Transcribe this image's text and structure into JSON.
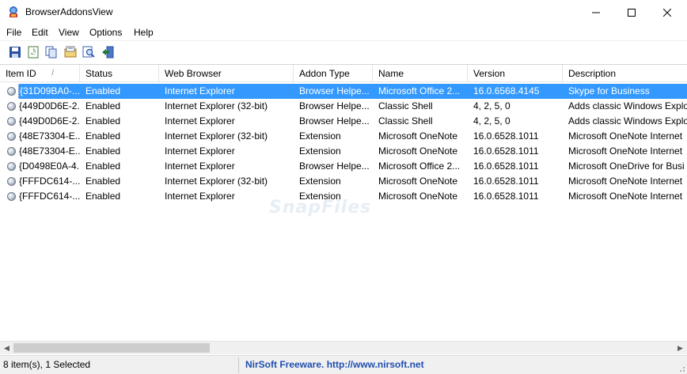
{
  "window": {
    "title": "BrowserAddonsView",
    "controls": [
      "minimize",
      "maximize",
      "close"
    ]
  },
  "menu": {
    "items": [
      {
        "label": "File",
        "name": "menu-file"
      },
      {
        "label": "Edit",
        "name": "menu-edit"
      },
      {
        "label": "View",
        "name": "menu-view"
      },
      {
        "label": "Options",
        "name": "menu-options"
      },
      {
        "label": "Help",
        "name": "menu-help"
      }
    ]
  },
  "toolbar": {
    "buttons": [
      {
        "icon": "save-icon"
      },
      {
        "icon": "refresh-icon"
      },
      {
        "icon": "copy-icon"
      },
      {
        "icon": "html-report-icon"
      },
      {
        "icon": "find-icon"
      },
      {
        "icon": "exit-icon"
      }
    ]
  },
  "table": {
    "columns": [
      "Item ID",
      "Status",
      "Web Browser",
      "Addon Type",
      "Name",
      "Version",
      "Description"
    ],
    "sort_indicator": "/",
    "rows": [
      {
        "id": "{31D09BA0-...",
        "status": "Enabled",
        "browser": "Internet Explorer",
        "type": "Browser Helpe...",
        "name": "Microsoft Office 2...",
        "version": "16.0.6568.4145",
        "description": "Skype for Business",
        "selected": true
      },
      {
        "id": "{449D0D6E-2...",
        "status": "Enabled",
        "browser": "Internet Explorer (32-bit)",
        "type": "Browser Helpe...",
        "name": "Classic Shell",
        "version": "4, 2, 5, 0",
        "description": "Adds classic Windows Explo",
        "selected": false
      },
      {
        "id": "{449D0D6E-2...",
        "status": "Enabled",
        "browser": "Internet Explorer",
        "type": "Browser Helpe...",
        "name": "Classic Shell",
        "version": "4, 2, 5, 0",
        "description": "Adds classic Windows Explo",
        "selected": false
      },
      {
        "id": "{48E73304-E...",
        "status": "Enabled",
        "browser": "Internet Explorer (32-bit)",
        "type": "Extension",
        "name": "Microsoft OneNote",
        "version": "16.0.6528.1011",
        "description": "Microsoft OneNote Internet",
        "selected": false
      },
      {
        "id": "{48E73304-E...",
        "status": "Enabled",
        "browser": "Internet Explorer",
        "type": "Extension",
        "name": "Microsoft OneNote",
        "version": "16.0.6528.1011",
        "description": "Microsoft OneNote Internet",
        "selected": false
      },
      {
        "id": "{D0498E0A-4...",
        "status": "Enabled",
        "browser": "Internet Explorer",
        "type": "Browser Helpe...",
        "name": "Microsoft Office 2...",
        "version": "16.0.6528.1011",
        "description": "Microsoft OneDrive for Busi",
        "selected": false
      },
      {
        "id": "{FFFDC614-...",
        "status": "Enabled",
        "browser": "Internet Explorer (32-bit)",
        "type": "Extension",
        "name": "Microsoft OneNote",
        "version": "16.0.6528.1011",
        "description": "Microsoft OneNote Internet",
        "selected": false
      },
      {
        "id": "{FFFDC614-...",
        "status": "Enabled",
        "browser": "Internet Explorer",
        "type": "Extension",
        "name": "Microsoft OneNote",
        "version": "16.0.6528.1011",
        "description": "Microsoft OneNote Internet",
        "selected": false
      }
    ]
  },
  "watermark": "SnapFiles",
  "status": {
    "count_text": "8 item(s), 1 Selected",
    "credit_text": "NirSoft Freeware.  http://www.nirsoft.net"
  },
  "colors": {
    "selection": "#3399ff",
    "credit_link": "#1f4fb0"
  }
}
